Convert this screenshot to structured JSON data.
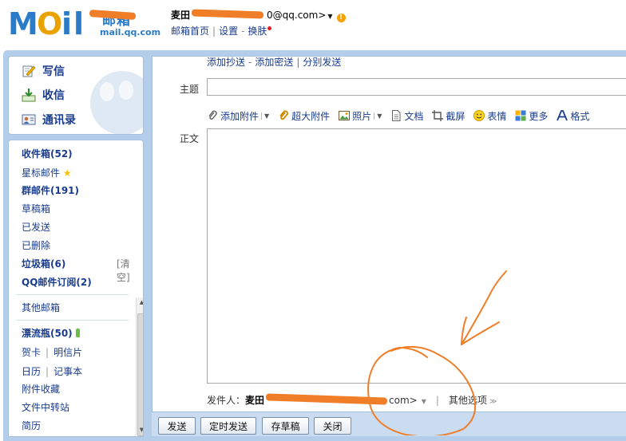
{
  "header": {
    "logo_cn": "邮箱",
    "logo_url": "mail.qq.com",
    "user_name": "麦田",
    "user_email": "0@qq.com>",
    "links": [
      "邮箱首页",
      "设置",
      "换肤"
    ]
  },
  "actions": [
    {
      "label": "写信",
      "icon": "compose-icon"
    },
    {
      "label": "收信",
      "icon": "inbox-download-icon"
    },
    {
      "label": "通讯录",
      "icon": "contacts-icon"
    }
  ],
  "folders": {
    "inbox": "收件箱(52)",
    "starred": "星标邮件",
    "group": "群邮件(191)",
    "drafts": "草稿箱",
    "sent": "已发送",
    "deleted": "已删除",
    "spam": "垃圾箱(6)",
    "spam_clear": "[清空]",
    "subscription": "QQ邮件订阅(2)",
    "other_mailbox": "其他邮箱",
    "drift_bottle": "漂流瓶(50)",
    "card": "贺卡",
    "postcard": "明信片",
    "calendar": "日历",
    "notebook": "记事本",
    "attachments": "附件收藏",
    "transfer": "文件中转站",
    "resume": "简历"
  },
  "compose": {
    "addr_links": [
      "添加抄送",
      "添加密送",
      "分别发送"
    ],
    "subject_label": "主题",
    "subject_value": "",
    "body_label": "正文",
    "body_value": "",
    "toolbar": [
      {
        "label": "添加附件",
        "icon": "paperclip-icon",
        "dropdown": true
      },
      {
        "label": "超大附件",
        "icon": "large-attachment-icon",
        "dropdown": false
      },
      {
        "label": "照片",
        "icon": "photo-icon",
        "dropdown": true
      },
      {
        "label": "文档",
        "icon": "document-icon",
        "dropdown": false
      },
      {
        "label": "截屏",
        "icon": "screenshot-icon",
        "dropdown": false
      },
      {
        "label": "表情",
        "icon": "smiley-icon",
        "dropdown": false
      },
      {
        "label": "更多",
        "icon": "more-icon",
        "dropdown": false
      },
      {
        "label": "格式",
        "icon": "format-icon",
        "dropdown": false
      }
    ],
    "sender_label": "发件人：",
    "sender_name": "麦田",
    "sender_email": "com>",
    "other_options": "其他选项"
  },
  "buttons": {
    "send": "发送",
    "scheduled": "定时发送",
    "save_draft": "存草稿",
    "close": "关闭"
  },
  "colors": {
    "brand_blue": "#2a7cc8",
    "link_blue": "#1a3c8c",
    "frame_blue": "#b3cdea",
    "annotation_orange": "#f07d28"
  }
}
